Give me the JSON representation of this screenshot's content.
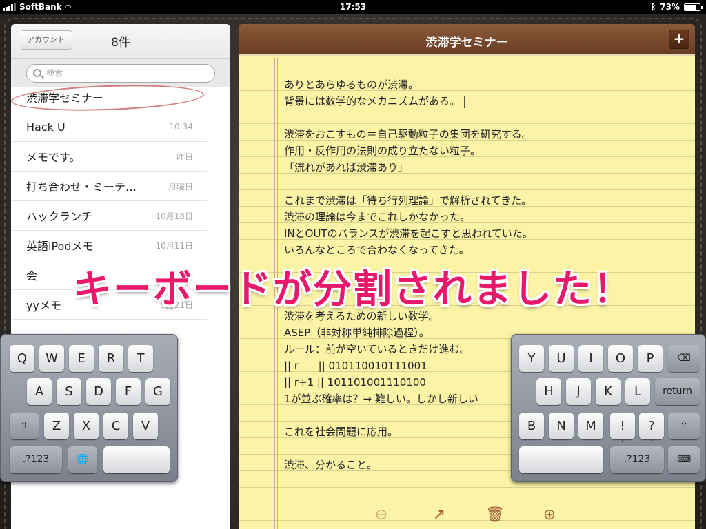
{
  "status_bar": {
    "carrier": "SoftBank",
    "time": "17:53",
    "battery": "73%",
    "battery_level": 0.73
  },
  "list_pane": {
    "back_label": "アカウント",
    "title": "8件",
    "search_placeholder": "検索",
    "notes": [
      {
        "title": "渋滞学セミナー",
        "date": ""
      },
      {
        "title": "Hack U",
        "date": "10:34"
      },
      {
        "title": "メモです。",
        "date": "昨日"
      },
      {
        "title": "打ち合わせ・ミーテ…",
        "date": "月曜日"
      },
      {
        "title": "ハックランチ",
        "date": "10月18日"
      },
      {
        "title": "英語iPodメモ",
        "date": "10月11日"
      },
      {
        "title": "会",
        "date": ""
      },
      {
        "title": "yyメモ",
        "date": "9月21日"
      }
    ]
  },
  "note_pane": {
    "title": "渋滞学セミナー",
    "add_label": "+",
    "body_lines": [
      "ありとあらゆるものが渋滞。",
      "背景には数学的なメカニズムがある。",
      "",
      "渋滞をおこすもの＝自己駆動粒子の集団を研究する。",
      "作用・反作用の法則の成り立たない粒子。",
      "「流れがあれば渋滞あり」",
      "",
      "これまで渋滞は「待ち行列理論」で解析されてきた。",
      "渋滞の理論は今までこれしかなかった。",
      "INとOUTのバランスが渋滞を起こすと思われていた。",
      "いろんなところで合わなくなってきた。",
      "",
      "",
      "",
      "渋滞を考えるための新しい数学。",
      "ASEP（非対称単純排除過程）。",
      "ルール：前が空いているときだけ進む。",
      "|| r      || 010110010111001",
      "|| r+1 || 101101001110100",
      "1が並ぶ確率は？→ 難しい。しかし新しい",
      "",
      "これを社会問題に応用。",
      "",
      "渋滞、分かること。"
    ]
  },
  "keyboard_left": {
    "row1": [
      "Q",
      "W",
      "E",
      "R",
      "T"
    ],
    "row2": [
      "A",
      "S",
      "D",
      "F",
      "G"
    ],
    "row3": [
      "Z",
      "X",
      "C",
      "V"
    ],
    "shift": "⇧",
    "numbers": ".?123",
    "globe": "🌐"
  },
  "keyboard_right": {
    "row1": [
      "Y",
      "U",
      "I",
      "O",
      "P"
    ],
    "delete": "⌫",
    "row2": [
      "H",
      "J",
      "K",
      "L"
    ],
    "return": "return",
    "row3": [
      "B",
      "N",
      "M"
    ],
    "excl": "!",
    "excl_sub": ",",
    "quest": "?",
    "quest_sub": ".",
    "shift": "⇧",
    "numbers": ".?123",
    "hide": "⌨"
  },
  "caption": "キーボードが分割されました！",
  "colors": {
    "caption": "#e8186b",
    "header": "#7a4a2e",
    "paper": "#fbf3a6"
  }
}
